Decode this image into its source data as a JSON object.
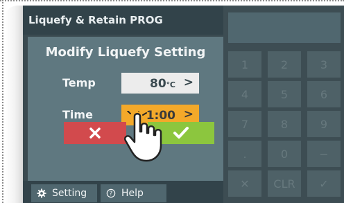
{
  "header": {
    "title": "Liquefy & Retain PROG"
  },
  "dialog": {
    "title": "Modify Liquefy Setting",
    "temp": {
      "label": "Temp",
      "value": "80",
      "unit": "℃"
    },
    "time": {
      "label": "Time",
      "value": "1:00"
    },
    "cancel_icon": "close-icon",
    "confirm_icon": "check-icon"
  },
  "footer": {
    "setting_label": "Setting",
    "help_label": "Help"
  },
  "keypad": {
    "keys": [
      "1",
      "2",
      "3",
      "4",
      "5",
      "6",
      "7",
      "8",
      "9",
      ".",
      "0",
      "−",
      "✕",
      "CLR",
      "✓"
    ]
  },
  "colors": {
    "cancel": "#d24a4d",
    "confirm": "#8cc63e",
    "active_field": "#f3a92a",
    "screen": "#3a4a50"
  }
}
